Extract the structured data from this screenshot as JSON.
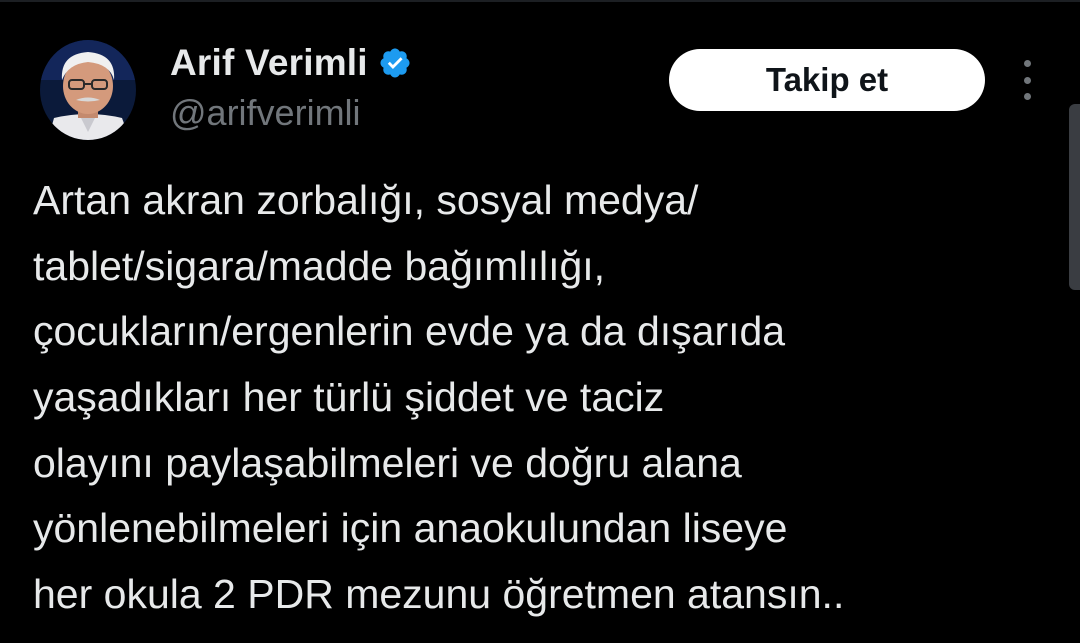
{
  "author": {
    "display_name": "Arif Verimli",
    "handle": "@arifverimli",
    "verified_icon": "verified-badge-icon",
    "avatar_icon": "profile-photo"
  },
  "actions": {
    "follow_label": "Takip et",
    "more_icon": "more-options-icon"
  },
  "tweet": {
    "lines": [
      "Artan akran zorbalığı, sosyal medya/",
      "tablet/sigara/madde bağımlılığı,",
      "çocukların/ergenlerin evde ya da dışarıda",
      "yaşadıkları her türlü şiddet ve taciz",
      "olayını paylaşabilmeleri ve doğru alana",
      "yönlenebilmeleri için anaokulundan liseye",
      "her okula 2 PDR mezunu öğretmen atansın.."
    ]
  },
  "colors": {
    "background": "#000000",
    "text_primary": "#e7e9ea",
    "text_secondary": "#71767b",
    "verified": "#1d9bf0",
    "follow_bg": "#ffffff",
    "follow_text": "#0f1419"
  }
}
